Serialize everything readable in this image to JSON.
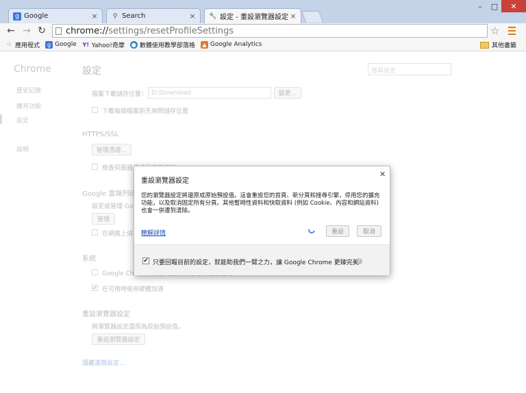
{
  "tabs": [
    {
      "label": "Google",
      "icon": "google-favicon",
      "color": "#3c78d8"
    },
    {
      "label": "Search",
      "icon": "search-icon"
    },
    {
      "label": "設定 - 重設瀏覽器設定",
      "icon": "wrench-icon"
    }
  ],
  "toolbar": {
    "url_host": "chrome://",
    "url_path": "settings/resetProfileSettings"
  },
  "bookmarks": [
    {
      "label": "應用程式",
      "icon": "apps-grid-icon"
    },
    {
      "label": "Google",
      "icon": "google-favicon"
    },
    {
      "label": "Yahoo!奇摩",
      "icon": "yahoo-favicon"
    },
    {
      "label": "數體使用教學部落格",
      "icon": "blog-favicon"
    },
    {
      "label": "Google Analytics",
      "icon": "analytics-favicon"
    }
  ],
  "bookmarks_other": "其他書籤",
  "sidebar": {
    "title": "Chrome",
    "items": [
      "歷史記錄",
      "擴充功能",
      "設定",
      "說明"
    ]
  },
  "settings": {
    "title": "設定",
    "search_placeholder": "搜尋設定",
    "download_location_label": "檔案下載儲存位置：",
    "download_path": "D:\\Download",
    "change_button": "變更...",
    "ask_download": "下載每個檔案前先詢問儲存位置",
    "https_heading": "HTTPS/SSL",
    "manage_certs": "管理憑證...",
    "check_revocation": "檢查伺服器憑證是否已撤銷",
    "cloud_print_heading": "Google 雲端列印",
    "cloud_print_desc": "設定或管理 Google",
    "manage_button": "管理",
    "cloud_print_check": "在網路上偵",
    "system_heading": "系統",
    "system_item1": "Google Chrome 關閉時繼續執行背景應用程式",
    "system_item2": "在可用時使用硬體加速",
    "reset_heading": "重設瀏覽器設定",
    "reset_desc": "將瀏覽器設定還原為原始預設值。",
    "reset_button": "重設瀏覽器設定",
    "hide_advanced": "隱藏進階設定..."
  },
  "dialog": {
    "title": "重設瀏覽器設定",
    "body": "您的瀏覽器設定將還原成原始預設值。這會重設您的首頁、新分頁和搜尋引擎，停用您的擴充功能，以及取消固定所有分頁。其他暫時性資料和快取資料 (例如 Cookie、內容和網站資料) 也會一併遭到清除。",
    "learn_more": "瞭解詳情",
    "reset_button": "重設",
    "cancel_button": "取消",
    "feedback_label": "只要回報目前的設定，就能助我們一臂之力，讓 Google Chrome 更臻完美",
    "feedback_checked": "✔"
  }
}
